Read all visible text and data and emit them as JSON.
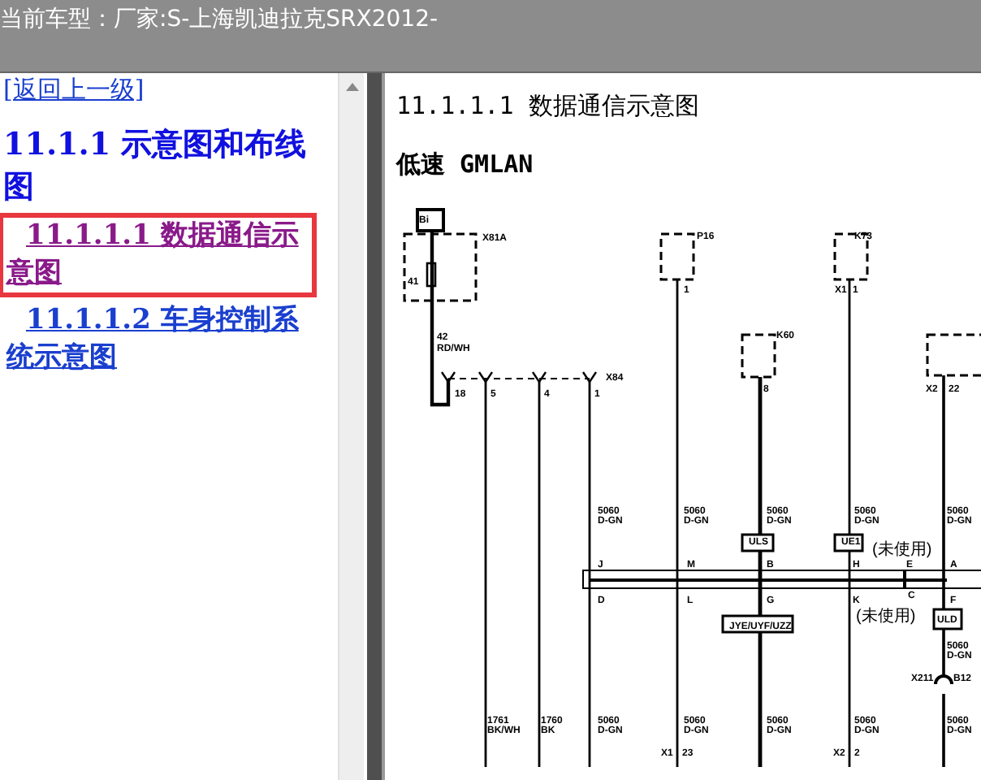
{
  "title_bar": {
    "text": "当前车型：厂家:S-上海凯迪拉克SRX2012-"
  },
  "sidebar": {
    "back_link": "[返回上一级]",
    "items": [
      {
        "kind": "heading",
        "label": "11.1.1 示意图和布线图",
        "selected": false
      },
      {
        "kind": "link",
        "label": "11.1.1.1 数据通信示意图",
        "selected": true
      },
      {
        "kind": "link",
        "label": "11.1.1.2 车身控制系统示意图",
        "selected": false
      }
    ]
  },
  "document": {
    "title": "11.1.1.1 数据通信示意图",
    "subtitle": "低速 GMLAN",
    "diagram_labels": [
      "Bi",
      "X81A",
      "41",
      "42",
      "RD/WH",
      "18",
      "5",
      "4",
      "1",
      "X84",
      "P16",
      "1",
      "K73",
      "X1",
      "1",
      "K60",
      "8",
      "X2",
      "22",
      "5060",
      "D-GN",
      "5060",
      "D-GN",
      "5060",
      "D-GN",
      "5060",
      "D-GN",
      "5060",
      "D-GN",
      "ULS",
      "UE1",
      "(未使用)",
      "J",
      "M",
      "B",
      "H",
      "E",
      "A",
      "D",
      "L",
      "G",
      "K",
      "C",
      "F",
      "(未使用)",
      "JYE/UYF/UZZ",
      "ULD",
      "5060",
      "D-GN",
      "X211",
      "B12",
      "1761",
      "BK/WH",
      "1760",
      "BK",
      "5060",
      "D-GN",
      "5060",
      "D-GN",
      "5060",
      "D-GN",
      "5060",
      "D-GN",
      "5060",
      "D-GN",
      "X1",
      "23",
      "X2",
      "2"
    ]
  }
}
